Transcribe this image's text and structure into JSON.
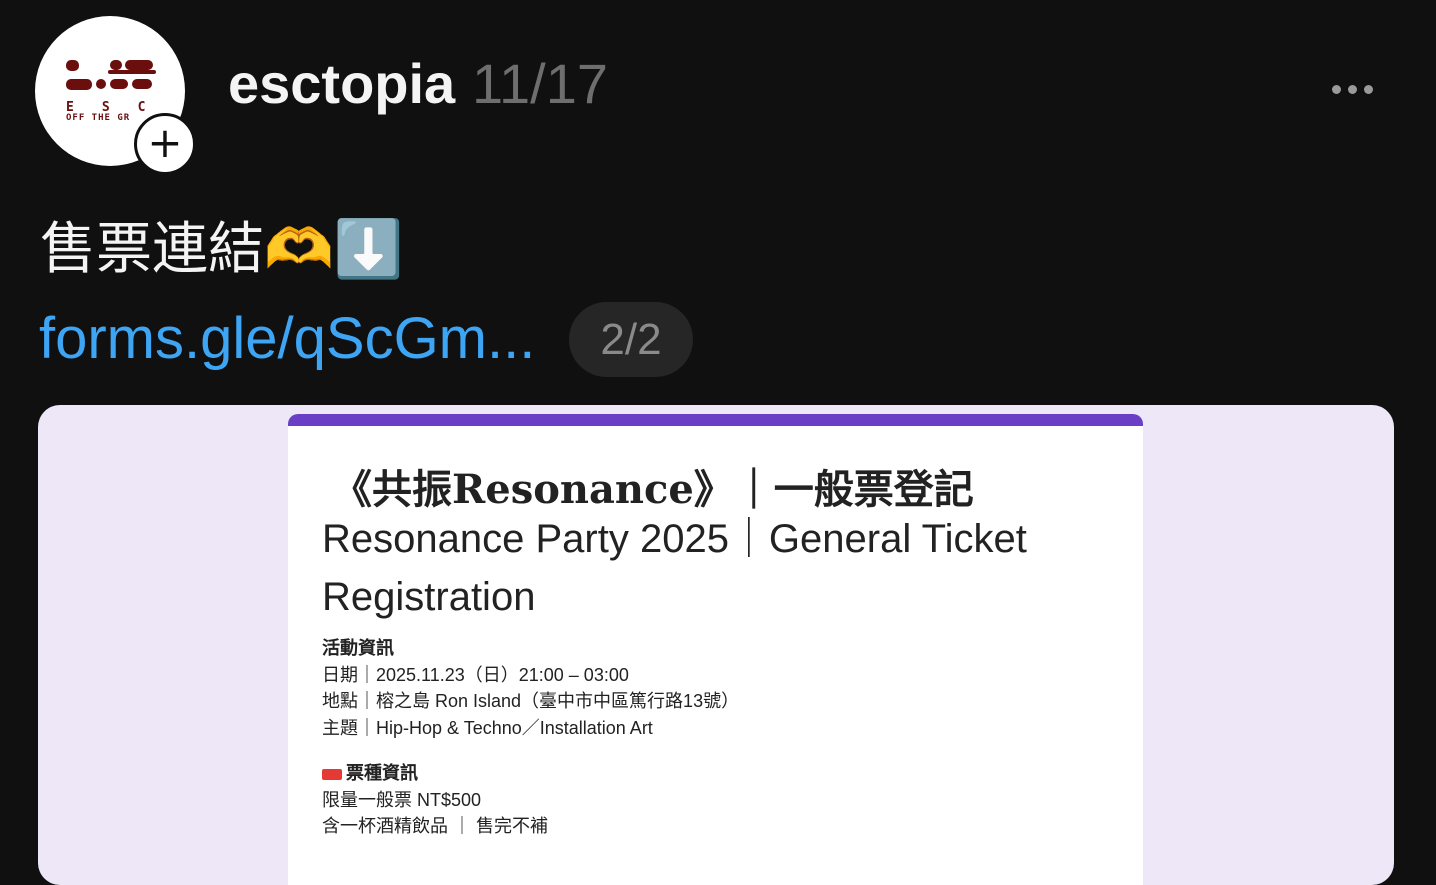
{
  "header": {
    "avatar_logo": {
      "letters": "ESC",
      "subtitle": "OFF THE GR"
    },
    "username": "esctopia",
    "date": "11/17",
    "follow_icon": "plus-icon",
    "more_icon": "more-horizontal-icon"
  },
  "post": {
    "text": "售票連結🫶⬇️",
    "link": "forms.gle/qScGm...",
    "counter": "2/2"
  },
  "preview": {
    "accent_color": "#6a3fc6",
    "title_zh": "《共振Resonance》｜一般票登記",
    "title_en": "Resonance Party 2025｜General Ticket Registration",
    "event_heading": "活動資訊",
    "event_lines": [
      "日期｜2025.11.23（日）21:00 – 03:00",
      "地點｜榕之島 Ron Island（臺中市中區篤行路13號）",
      "主題｜Hip-Hop & Techno／Installation Art"
    ],
    "ticket_heading": "票種資訊",
    "ticket_icon": "ticket-icon",
    "ticket_lines": [
      "限量一般票 NT$500",
      "含一杯酒精飲品 ｜ 售完不補"
    ]
  }
}
